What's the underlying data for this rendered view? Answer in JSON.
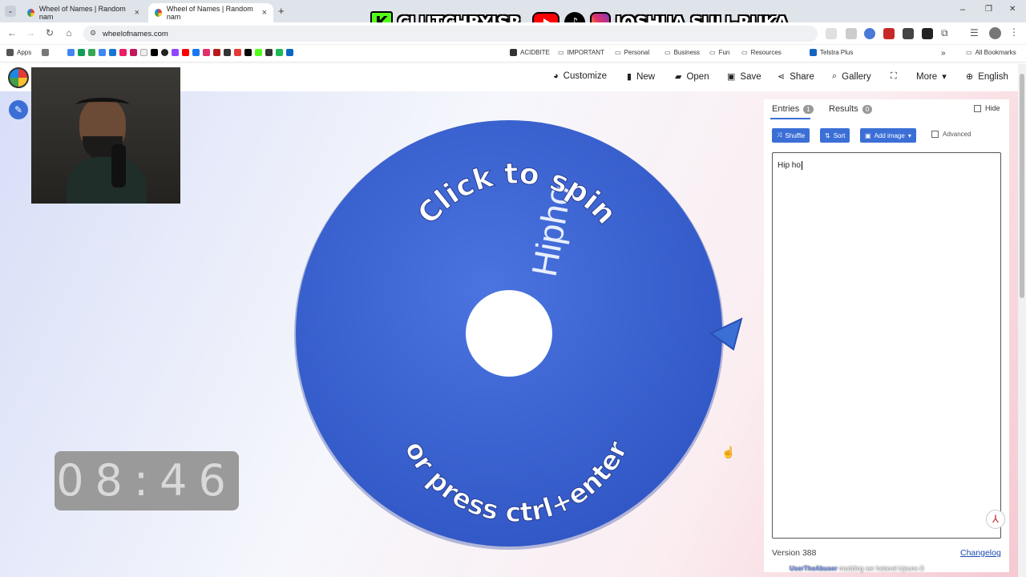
{
  "browser": {
    "tabs": [
      {
        "title": "Wheel of Names | Random nam",
        "close": "×"
      },
      {
        "title": "Wheel of Names | Random nam",
        "close": "×"
      }
    ],
    "new_tab": "+",
    "window_controls": {
      "minimize": "–",
      "restore": "❐",
      "close": "✕"
    },
    "url": "wheelofnames.com",
    "bookmarks": [
      "Apps",
      "ACIDBITE",
      "IMPORTANT",
      "Personal",
      "Business",
      "Fun",
      "Resources",
      "Telstra Plus",
      "All Bookmarks"
    ]
  },
  "stream_overlay": {
    "kick_name": "CLUTCHBYJSR",
    "social_name": "JOSHUA SULI-RUKA"
  },
  "appbar": {
    "menu": [
      "Customize",
      "New",
      "Open",
      "Save",
      "Share",
      "Gallery",
      "More",
      "English"
    ]
  },
  "wheel": {
    "color": "#3a63d4",
    "entry_label": "Hipho",
    "top_text": "Click to spin",
    "bottom_text": "or press ctrl+enter"
  },
  "timer": {
    "value": "08:46"
  },
  "sidepanel": {
    "tabs": [
      {
        "label": "Entries",
        "count": "1"
      },
      {
        "label": "Results",
        "count": "0"
      }
    ],
    "hide_label": "Hide",
    "buttons": {
      "shuffle": "Shuffle",
      "sort": "Sort",
      "add_image": "Add image"
    },
    "advanced_label": "Advanced",
    "entries_text": "Hip ho",
    "version": "Version 388",
    "changelog": "Changelog"
  },
  "chat_line": {
    "user": "UserTheAbuser",
    "message": "modding ser hataval trjauns ili"
  }
}
